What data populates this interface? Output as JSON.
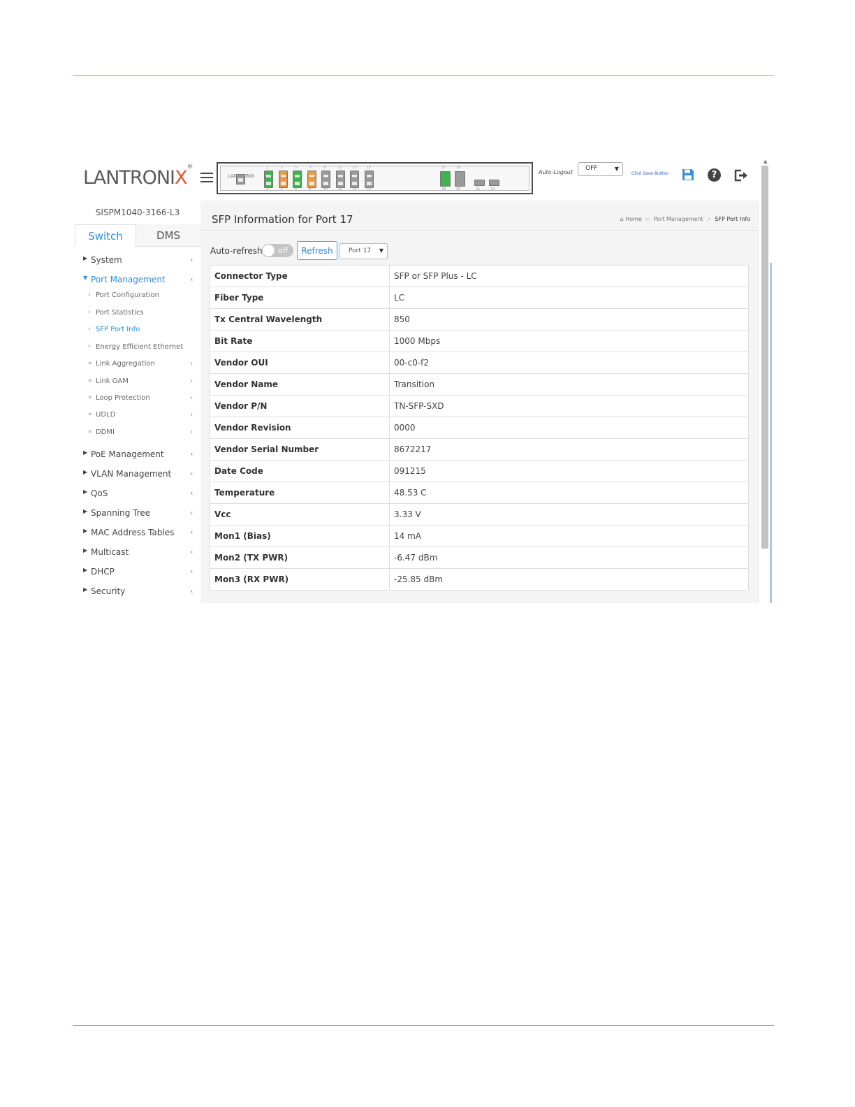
{
  "header": {
    "logo_text": "LANTRONI",
    "logo_x": "X",
    "logo_reg": "®",
    "panel_brand": "LANTRONIX",
    "auto_logout_label": "Auto-Logout",
    "auto_logout_value": "OFF",
    "save_hint": "Click Save Button"
  },
  "ports": {
    "top_numbers": [
      "1",
      "3",
      "5",
      "7",
      "9",
      "11",
      "13",
      "15"
    ],
    "bottom_numbers": [
      "2",
      "4",
      "6",
      "8",
      "10",
      "12",
      "14",
      "16"
    ],
    "top_colors": [
      "#3db34a",
      "#e89a4a",
      "#3db34a",
      "#e89a4a",
      "#9a9a9a",
      "#9a9a9a",
      "#9a9a9a",
      "#9a9a9a"
    ],
    "bottom_colors": [
      "#3db34a",
      "#e89a4a",
      "#3db34a",
      "#e89a4a",
      "#9a9a9a",
      "#9a9a9a",
      "#9a9a9a",
      "#9a9a9a"
    ],
    "sfp_top_numbers": [
      "17",
      "19"
    ],
    "sfp_bottom_numbers": [
      "18",
      "20",
      "21",
      "22"
    ],
    "sfp_colors": [
      "#3db34a",
      "#9a9a9a"
    ]
  },
  "sidebar": {
    "device_name": "SISPM1040-3166-L3",
    "tabs": {
      "switch": "Switch",
      "dms": "DMS"
    },
    "items": {
      "system": "System",
      "port_management": "Port Management",
      "poe_management": "PoE Management",
      "vlan_management": "VLAN Management",
      "qos": "QoS",
      "spanning_tree": "Spanning Tree",
      "mac_address_tables": "MAC Address Tables",
      "multicast": "Multicast",
      "dhcp": "DHCP",
      "security": "Security"
    },
    "sub_items": {
      "port_configuration": "Port Configuration",
      "port_statistics": "Port Statistics",
      "sfp_port_info": "SFP Port Info",
      "energy_efficient_ethernet": "Energy Efficient Ethernet",
      "link_aggregation": "Link Aggregation",
      "link_oam": "Link OAM",
      "loop_protection": "Loop Protection",
      "udld": "UDLD",
      "ddmi": "DDMI"
    }
  },
  "content": {
    "title": "SFP Information for  Port 17",
    "breadcrumb": {
      "home": "Home",
      "section": "Port Management",
      "current": "SFP Port Info"
    },
    "auto_refresh_label": "Auto-refresh",
    "toggle_text": "off",
    "refresh_label": "Refresh",
    "port_select_value": "Port 17",
    "rows": [
      {
        "key": "Connector Type",
        "value": "SFP or SFP Plus - LC"
      },
      {
        "key": "Fiber Type",
        "value": "LC"
      },
      {
        "key": "Tx Central Wavelength",
        "value": "850"
      },
      {
        "key": "Bit Rate",
        "value": "1000 Mbps"
      },
      {
        "key": "Vendor OUI",
        "value": "00-c0-f2"
      },
      {
        "key": "Vendor Name",
        "value": "Transition"
      },
      {
        "key": "Vendor P/N",
        "value": "TN-SFP-SXD"
      },
      {
        "key": "Vendor Revision",
        "value": "0000"
      },
      {
        "key": "Vendor Serial Number",
        "value": "8672217"
      },
      {
        "key": "Date Code",
        "value": "091215"
      },
      {
        "key": "Temperature",
        "value": "48.53 C"
      },
      {
        "key": "Vcc",
        "value": "3.33 V"
      },
      {
        "key": "Mon1 (Bias)",
        "value": "14 mA"
      },
      {
        "key": "Mon2 (TX PWR)",
        "value": "-6.47 dBm"
      },
      {
        "key": "Mon3 (RX PWR)",
        "value": "-25.85 dBm"
      }
    ]
  }
}
